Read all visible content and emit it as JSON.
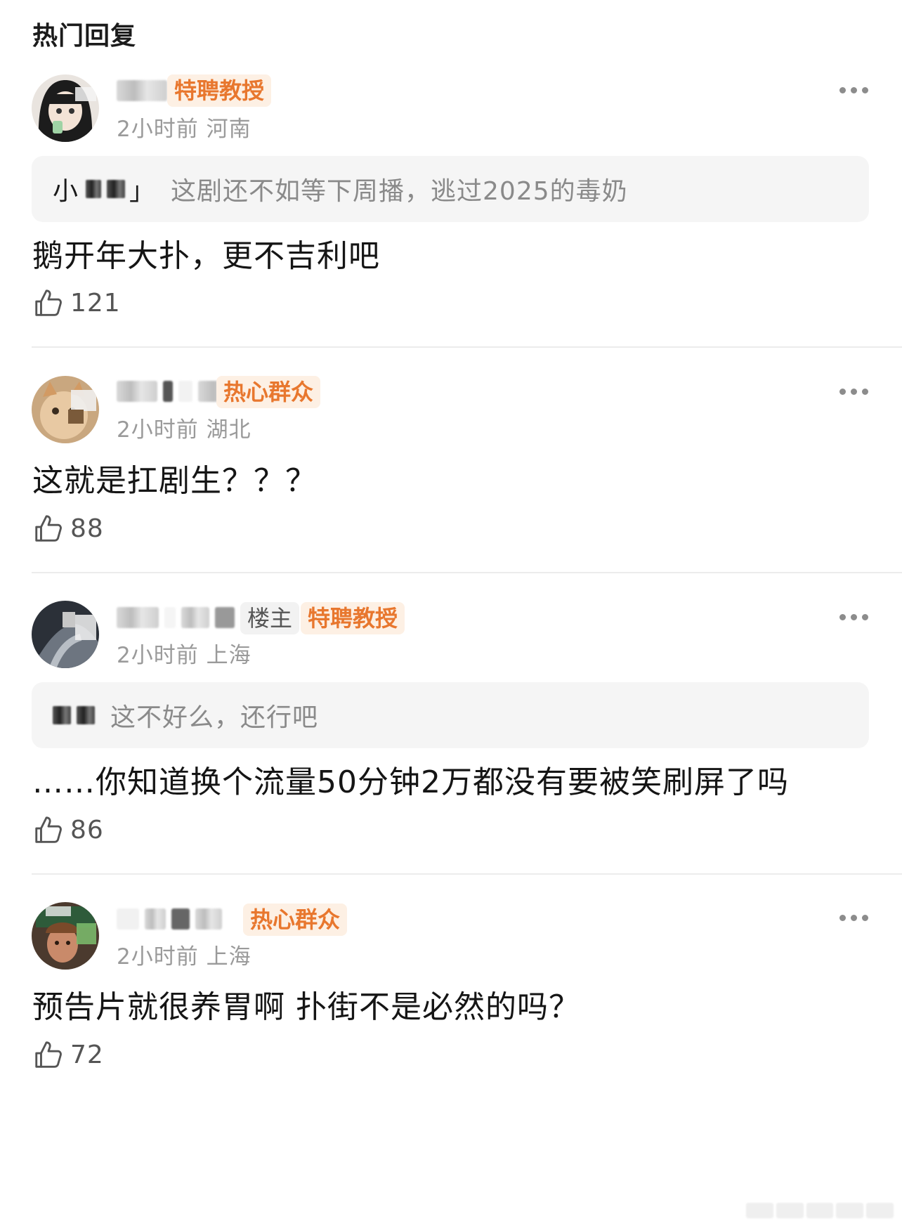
{
  "section_title": "热门回复",
  "comments": [
    {
      "username_tail": "",
      "badges": [
        {
          "label": "特聘教授",
          "kind": "orange"
        }
      ],
      "meta": "2小时前 河南",
      "quote": {
        "text": "这剧还不如等下周播，逃过2025的毒奶",
        "name_prefix": "小"
      },
      "body": "鹅开年大扑，更不吉利吧",
      "likes": "121"
    },
    {
      "username_tail": "",
      "badges": [
        {
          "label": "热心群众",
          "kind": "orange"
        }
      ],
      "meta": "2小时前 湖北",
      "quote": null,
      "body": "这就是扛剧生？？？",
      "likes": "88"
    },
    {
      "username_tail": "",
      "badges": [
        {
          "label": "楼主",
          "kind": "grey"
        },
        {
          "label": "特聘教授",
          "kind": "orange"
        }
      ],
      "meta": "2小时前 上海",
      "quote": {
        "text": "这不好么，还行吧",
        "name_prefix": ""
      },
      "body": "……你知道换个流量50分钟2万都没有要被笑刷屏了吗",
      "likes": "86"
    },
    {
      "username_tail": "",
      "badges": [
        {
          "label": "热心群众",
          "kind": "orange"
        }
      ],
      "meta": "2小时前 上海",
      "quote": null,
      "body": "预告片就很养胃啊 扑街不是必然的吗？",
      "likes": "72"
    }
  ],
  "icons": {
    "more": "more-horizontal-icon",
    "like": "thumbs-up-icon"
  },
  "colors": {
    "badge_orange_text": "#e8772e",
    "badge_orange_bg": "#fdf0e4",
    "badge_grey_bg": "#f2f2f2",
    "meta_text": "#9a9a9a",
    "quote_bg": "#f5f5f5"
  }
}
